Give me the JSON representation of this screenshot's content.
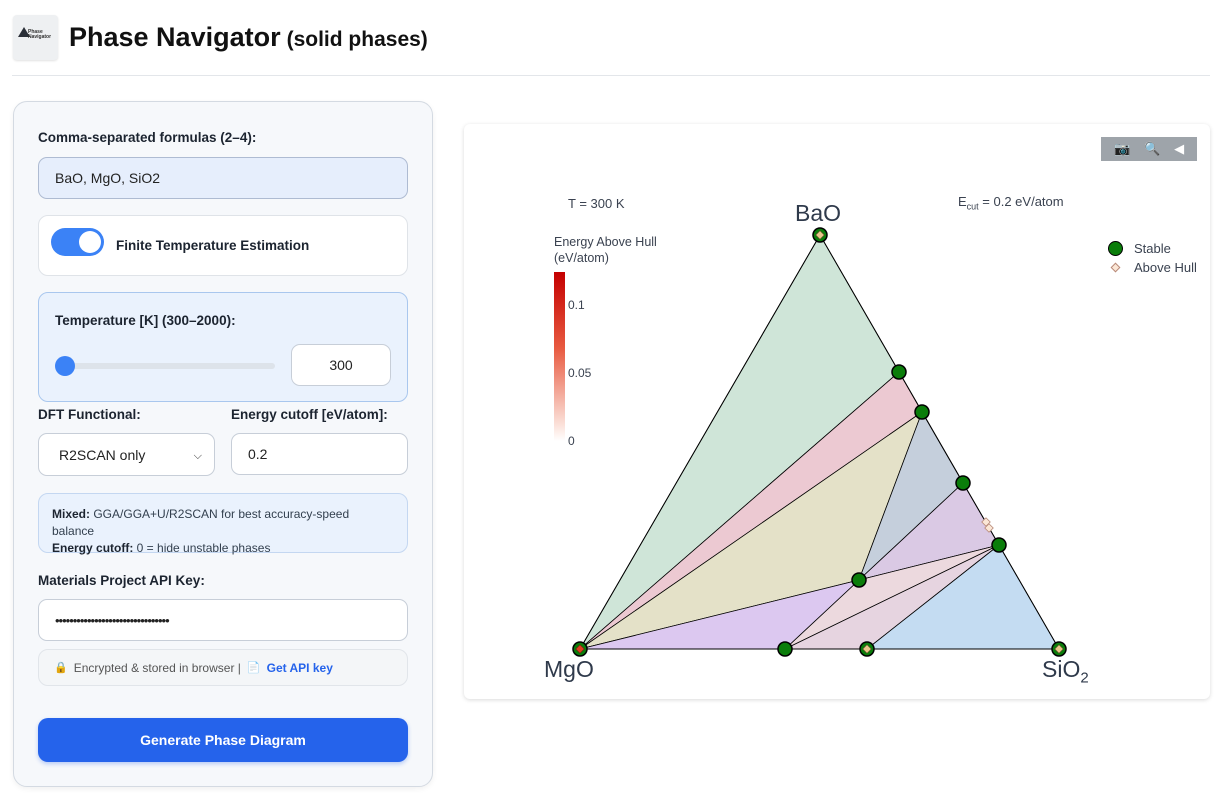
{
  "header": {
    "logo_text_1": "Phase",
    "logo_text_2": "Navigator",
    "title": "Phase Navigator",
    "subtitle": "(solid phases)"
  },
  "form": {
    "formulas_label": "Comma-separated formulas (2–4):",
    "formulas_value": "BaO, MgO, SiO2",
    "finite_temp_label": "Finite Temperature Estimation",
    "finite_temp_enabled": true,
    "temperature_label": "Temperature [K] (300–2000):",
    "temperature_value": "300",
    "temperature_slider_fraction": 0.0,
    "functional_label": "DFT Functional:",
    "functional_value": "R2SCAN only",
    "cutoff_label": "Energy cutoff [eV/atom]:",
    "cutoff_value": "0.2",
    "info_mixed_label": "Mixed:",
    "info_mixed_text": " GGA/GGA+U/R2SCAN for best accuracy-speed balance",
    "info_cutoff_label": "Energy cutoff:",
    "info_cutoff_text": " 0 = hide unstable phases",
    "api_key_label": "Materials Project API Key:",
    "api_key_value": "••••••••••••••••••••••••••••••••",
    "api_note_text": "Encrypted & stored in browser |",
    "api_link_text": "Get API key",
    "generate_button": "Generate Phase Diagram"
  },
  "plot": {
    "temperature_text": "T = 300 K",
    "ecut_prefix": "E",
    "ecut_sub": "cut",
    "ecut_suffix": " = 0.2 eV/atom",
    "colorbar_title_1": "Energy Above Hull",
    "colorbar_title_2": "(eV/atom)",
    "colorbar_ticks": [
      "0.1",
      "0.05",
      "0"
    ],
    "legend": [
      "Stable",
      "Above Hull"
    ],
    "vertex_top": "BaO",
    "vertex_left": "MgO",
    "vertex_right_main": "SiO",
    "vertex_right_sub": "2",
    "colors": {
      "stable": "#0a7d0a",
      "above_hull": "#fbe7d6",
      "accent": "#2563eb"
    }
  }
}
